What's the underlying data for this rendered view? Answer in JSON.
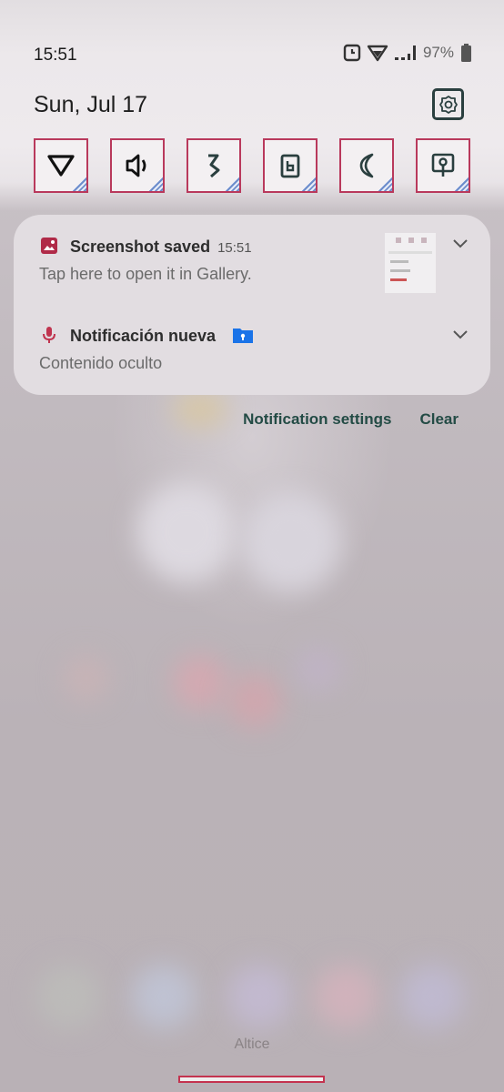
{
  "status_bar": {
    "time": "15:51",
    "battery": "97%",
    "icons": [
      "alarm-icon",
      "wifi-icon",
      "signal-icon",
      "battery-icon"
    ]
  },
  "header": {
    "date": "Sun, Jul 17",
    "settings_icon": "gear-icon"
  },
  "quick_tiles": [
    {
      "name": "wifi-tile",
      "icon": "wifi-triangle-icon"
    },
    {
      "name": "sound-tile",
      "icon": "speaker-icon"
    },
    {
      "name": "bluetooth-tile",
      "icon": "bluetooth-icon"
    },
    {
      "name": "battery-saver-tile",
      "icon": "battery-saver-icon"
    },
    {
      "name": "dark-mode-tile",
      "icon": "moon-icon"
    },
    {
      "name": "screen-cast-tile",
      "icon": "cast-icon"
    }
  ],
  "notifications": [
    {
      "title": "Screenshot saved",
      "time": "15:51",
      "body": "Tap here to open it in Gallery.",
      "icon": "image-icon"
    },
    {
      "title": "Notificación nueva",
      "body": "Contenido oculto",
      "icon": "microphone-icon",
      "badge_icon": "locked-folder-icon"
    }
  ],
  "actions": {
    "settings_label": "Notification settings",
    "clear_label": "Clear"
  },
  "carrier": "Altice",
  "colors": {
    "accent": "#b9395c",
    "action_text": "#234b45",
    "card_bg": "#e2dde1"
  }
}
